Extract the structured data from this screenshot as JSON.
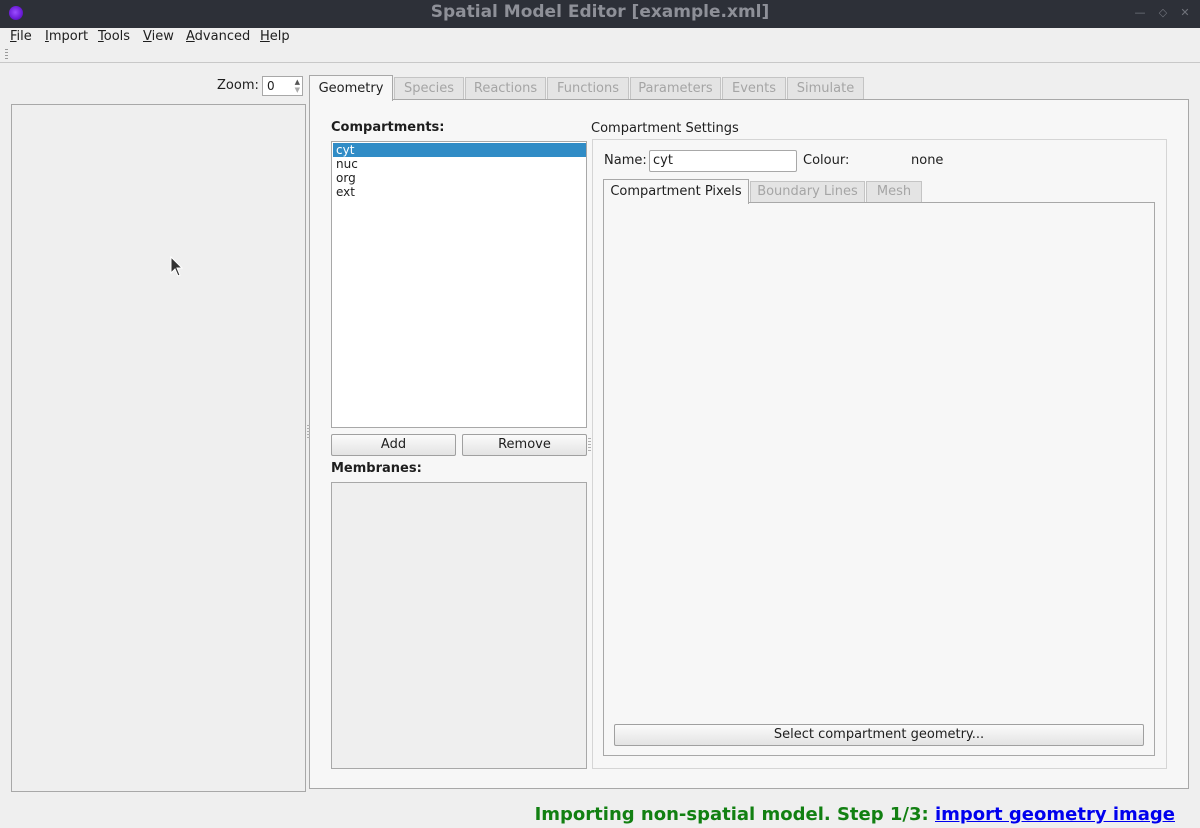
{
  "window": {
    "title": "Spatial Model Editor [example.xml]",
    "controls": [
      "minimize-icon",
      "maximize-icon",
      "close-icon"
    ]
  },
  "menubar": {
    "items": [
      {
        "label": "File",
        "mnemonic": "F",
        "rest": "ile"
      },
      {
        "label": "Import",
        "mnemonic": "I",
        "rest": "mport"
      },
      {
        "label": "Tools",
        "mnemonic": "T",
        "rest": "ools"
      },
      {
        "label": "View",
        "mnemonic": "V",
        "rest": "iew"
      },
      {
        "label": "Advanced",
        "mnemonic": "A",
        "rest": "dvanced"
      },
      {
        "label": "Help",
        "mnemonic": "H",
        "rest": "elp"
      }
    ]
  },
  "zoom": {
    "label": "Zoom:",
    "value": "0"
  },
  "tabs": [
    {
      "label": "Geometry",
      "active": true
    },
    {
      "label": "Species",
      "active": false
    },
    {
      "label": "Reactions",
      "active": false
    },
    {
      "label": "Functions",
      "active": false
    },
    {
      "label": "Parameters",
      "active": false
    },
    {
      "label": "Events",
      "active": false
    },
    {
      "label": "Simulate",
      "active": false
    }
  ],
  "geometry": {
    "compartments_label": "Compartments:",
    "compartments": [
      "cyt",
      "nuc",
      "org",
      "ext"
    ],
    "selected_compartment": "cyt",
    "add_label": "Add",
    "remove_label": "Remove",
    "membranes_label": "Membranes:",
    "membranes": [],
    "settings": {
      "title": "Compartment Settings",
      "name_label": "Name:",
      "name_value": "cyt",
      "colour_label": "Colour:",
      "colour_value": "none",
      "subtabs": [
        {
          "label": "Compartment Pixels",
          "active": true
        },
        {
          "label": "Boundary Lines",
          "active": false
        },
        {
          "label": "Mesh",
          "active": false
        }
      ],
      "select_geometry_label": "Select compartment geometry..."
    }
  },
  "status": {
    "text": "Importing non-spatial model. Step 1/3: ",
    "link": "import geometry image",
    "color": "#128012",
    "link_color": "#0000ee"
  },
  "colors": {
    "titlebar": "#2d3038",
    "selection": "#308cc6",
    "app_icon": "#6a1bd6"
  }
}
